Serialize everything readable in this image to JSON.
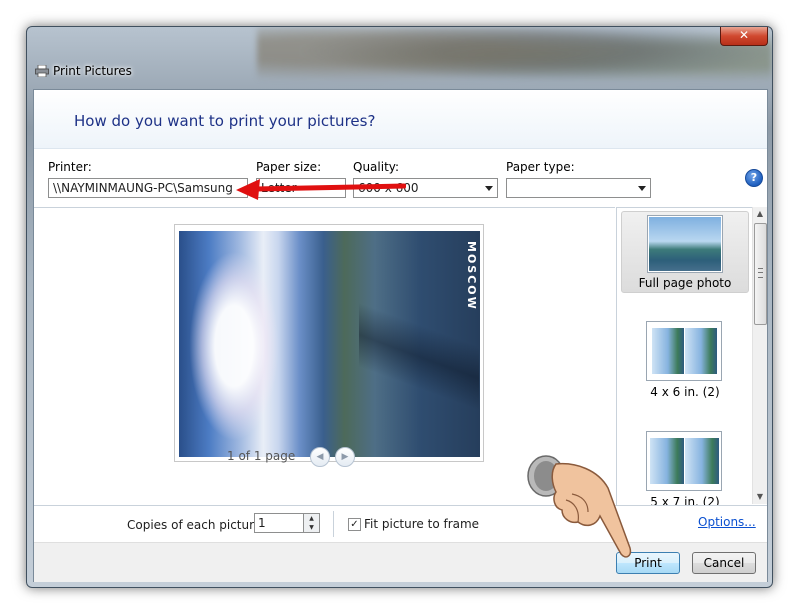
{
  "window": {
    "title": "Print Pictures",
    "close_glyph": "✕"
  },
  "dialog": {
    "heading": "How do you want to print your pictures?"
  },
  "settings": {
    "printer_label": "Printer:",
    "printer_value": "\\\\NAYMINMAUNG-PC\\Samsung",
    "paper_size_label": "Paper size:",
    "paper_size_value": "Letter",
    "quality_label": "Quality:",
    "quality_value": "600 x 600",
    "paper_type_label": "Paper type:",
    "paper_type_value": "",
    "help_glyph": "?"
  },
  "preview": {
    "photo_caption": "MOSCOW",
    "page_label": "1 of 1 page",
    "prev_glyph": "◀",
    "next_glyph": "▶"
  },
  "layouts": [
    {
      "label": "Full page photo",
      "selected": true
    },
    {
      "label": "4 x 6 in. (2)",
      "selected": false
    },
    {
      "label": "5 x 7 in. (2)",
      "selected": false
    }
  ],
  "scrollbar": {
    "up_glyph": "▲",
    "down_glyph": "▼"
  },
  "options": {
    "copies_label": "Copies of each picture:",
    "copies_value": "1",
    "fit_label": "Fit picture to frame",
    "fit_checked": true,
    "check_glyph": "✓",
    "options_link": "Options..."
  },
  "buttons": {
    "print": "Print",
    "cancel": "Cancel"
  },
  "colors": {
    "heading": "#1e3287",
    "link": "#0b50d0",
    "annotation_arrow": "#e01010"
  },
  "annotations": {
    "arrow_icon": "red-arrow-left",
    "cursor_icon": "pointing-hand-cursor"
  }
}
